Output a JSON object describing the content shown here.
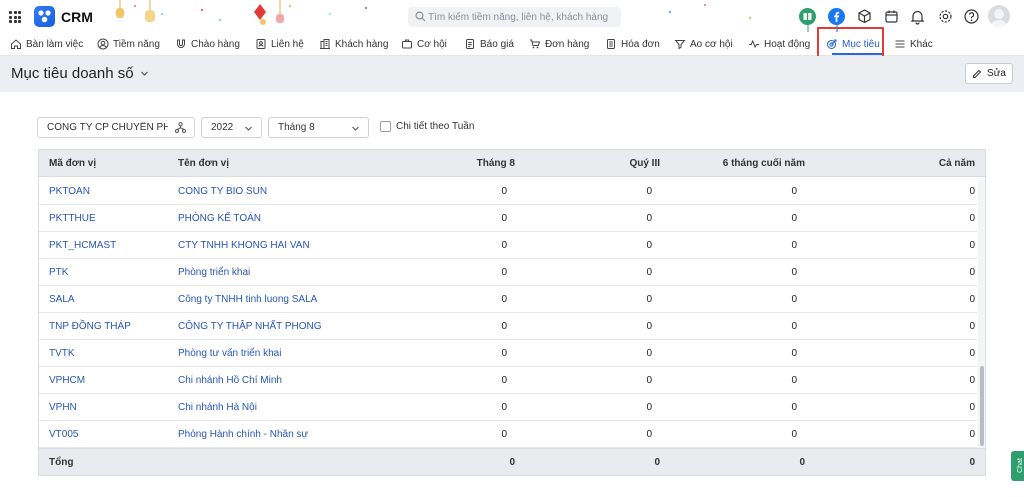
{
  "app": {
    "name": "CRM"
  },
  "search": {
    "placeholder": "Tìm kiếm tiềm năng, liên hệ, khách hàng"
  },
  "nav": {
    "items": [
      {
        "label": "Bàn làm việc"
      },
      {
        "label": "Tiềm năng"
      },
      {
        "label": "Chào hàng"
      },
      {
        "label": "Liên hệ"
      },
      {
        "label": "Khách hàng"
      },
      {
        "label": "Cơ hội"
      },
      {
        "label": "Báo giá"
      },
      {
        "label": "Đơn hàng"
      },
      {
        "label": "Hóa đơn"
      },
      {
        "label": "Ao cơ hội"
      },
      {
        "label": "Hoạt động"
      },
      {
        "label": "Mục tiêu"
      },
      {
        "label": "Khác"
      }
    ],
    "active": "Mục tiêu",
    "accent_color": "#2b64e0",
    "highlight_color": "#e53935"
  },
  "page": {
    "title": "Mục tiêu doanh số",
    "edit_label": "Sửa"
  },
  "filters": {
    "company": "CÔNG TY CP CHUYỂN PHÁT N...",
    "year": "2022",
    "month": "Tháng 8",
    "weekly_detail_label": "Chi tiết theo Tuần",
    "weekly_detail_checked": false
  },
  "table": {
    "columns": [
      "Mã đơn vị",
      "Tên đơn vị",
      "Tháng 8",
      "Quý III",
      "6 tháng cuối năm",
      "Cả năm"
    ],
    "rows": [
      {
        "code": "PKTOAN",
        "name": "CONG TY BIO SUN",
        "month": "0",
        "quarter": "0",
        "half": "0",
        "year": "0"
      },
      {
        "code": "PKTTHUE",
        "name": "PHÒNG KẾ TOÁN",
        "month": "0",
        "quarter": "0",
        "half": "0",
        "year": "0"
      },
      {
        "code": "PKT_HCMAST",
        "name": "CTY TNHH KHONG HAI VAN",
        "month": "0",
        "quarter": "0",
        "half": "0",
        "year": "0"
      },
      {
        "code": "PTK",
        "name": "Phòng triển khai",
        "month": "0",
        "quarter": "0",
        "half": "0",
        "year": "0"
      },
      {
        "code": "SALA",
        "name": "Công ty TNHH tinh luong SALA",
        "month": "0",
        "quarter": "0",
        "half": "0",
        "year": "0"
      },
      {
        "code": "TNP ĐỒNG THÁP",
        "name": "CÔNG TY THẬP NHẤT PHONG",
        "month": "0",
        "quarter": "0",
        "half": "0",
        "year": "0"
      },
      {
        "code": "TVTK",
        "name": "Phòng tư vấn triển khai",
        "month": "0",
        "quarter": "0",
        "half": "0",
        "year": "0"
      },
      {
        "code": "VPHCM",
        "name": "Chi nhánh Hồ Chí Minh",
        "month": "0",
        "quarter": "0",
        "half": "0",
        "year": "0"
      },
      {
        "code": "VPHN",
        "name": "Chi nhánh Hà Nội",
        "month": "0",
        "quarter": "0",
        "half": "0",
        "year": "0"
      },
      {
        "code": "VT005",
        "name": "Phòng Hành chính - Nhân sự",
        "month": "0",
        "quarter": "0",
        "half": "0",
        "year": "0"
      }
    ],
    "footer": {
      "label": "Tổng",
      "month": "0",
      "quarter": "0",
      "half": "0",
      "year": "0"
    }
  },
  "chat": {
    "label": "Chat"
  }
}
